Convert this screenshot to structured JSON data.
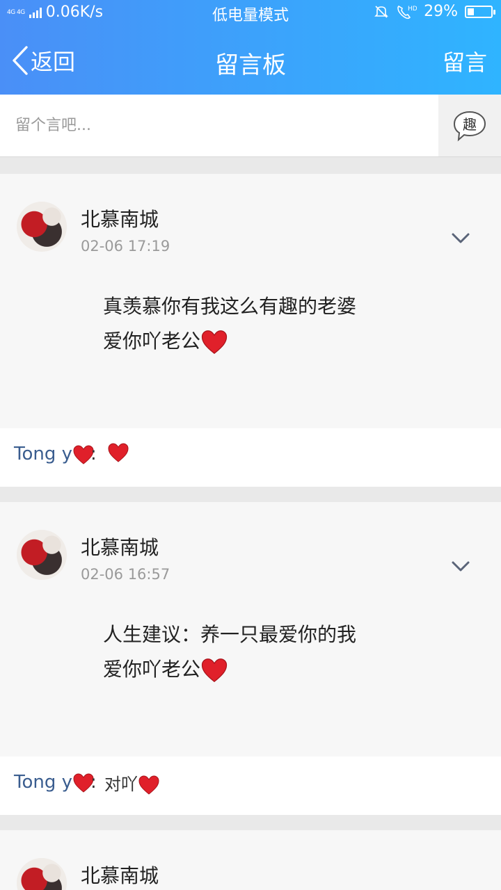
{
  "status_bar": {
    "network": "4G 4G",
    "speed": "0.06K/s",
    "mode": "低电量模式",
    "battery": "29%",
    "battery_level": 0.29
  },
  "nav": {
    "back_label": "返回",
    "title": "留言板",
    "post_label": "留言"
  },
  "input": {
    "placeholder": "留个言吧...",
    "fun_label": "趣"
  },
  "posts": [
    {
      "author": "北慕南城",
      "time": "02-06 17:19",
      "lines": [
        "真羡慕你有我这么有趣的老婆",
        "爱你吖老公"
      ],
      "reply": {
        "name": "Tong y",
        "colon": ":",
        "text": ""
      }
    },
    {
      "author": "北慕南城",
      "time": "02-06 16:57",
      "lines": [
        "人生建议：养一只最爱你的我",
        "爱你吖老公"
      ],
      "reply": {
        "name": "Tong y",
        "colon": ":",
        "text": "对吖"
      }
    },
    {
      "author": "北慕南城"
    }
  ],
  "colors": {
    "header_start": "#4a8ff7",
    "header_end": "#2fb4ff",
    "reply_name": "#3a5d8f",
    "heart": "#e0202a"
  },
  "icons": [
    "chevron-left-icon",
    "chat-bubble-icon",
    "chevron-down-icon",
    "heart-icon",
    "bell-mute-icon",
    "hd-call-icon",
    "battery-icon",
    "signal-icon"
  ]
}
